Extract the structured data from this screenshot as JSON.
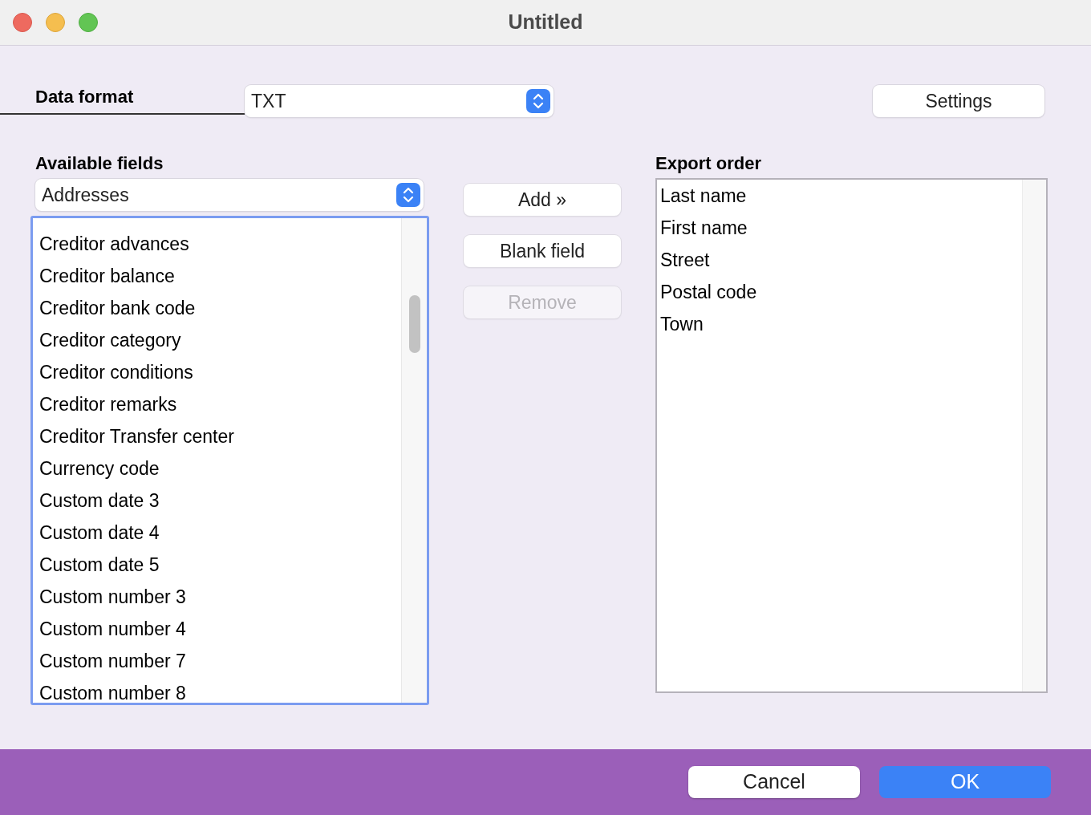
{
  "window": {
    "title": "Untitled"
  },
  "data_format": {
    "label": "Data format",
    "value": "TXT"
  },
  "settings_button": {
    "label": "Settings"
  },
  "available": {
    "label": "Available fields",
    "category": "Addresses",
    "focused": true,
    "items": [
      "Creditor advances",
      "Creditor balance",
      "Creditor bank code",
      "Creditor category",
      "Creditor conditions",
      "Creditor remarks",
      "Creditor Transfer center",
      "Currency code",
      "Custom date 3",
      "Custom date 4",
      "Custom date 5",
      "Custom number 3",
      "Custom number 4",
      "Custom number 7",
      "Custom number 8"
    ]
  },
  "actions": [
    {
      "label": "Add »",
      "disabled": false
    },
    {
      "label": "Blank field",
      "disabled": false
    },
    {
      "label": "Remove",
      "disabled": true
    }
  ],
  "export_order": {
    "label": "Export order",
    "items": [
      "Last name",
      "First name",
      "Street",
      "Postal code",
      "Town"
    ]
  },
  "footer_buttons": [
    {
      "label": "Cancel",
      "primary": false
    },
    {
      "label": "OK",
      "primary": true
    }
  ]
}
